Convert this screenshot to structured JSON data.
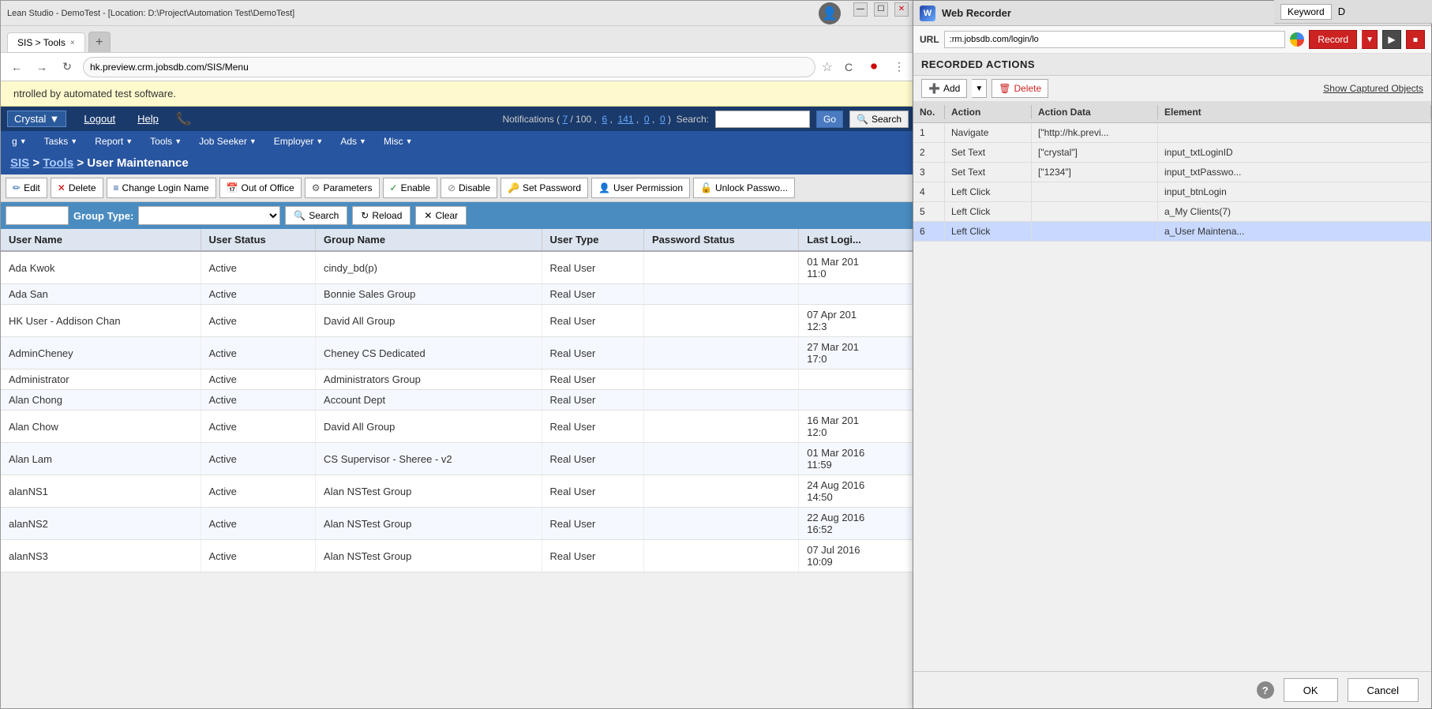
{
  "browser": {
    "titlebar_text": "Lean Studio - DemoTest - [Location: D:\\Project\\Automation Test\\DemoTest]",
    "tab_label": "SIS > Tools",
    "tab_close": "×",
    "url": "hk.preview.crm.jobsdb.com/SIS/Menu"
  },
  "automation_banner": {
    "text": "ntrolled by automated test software."
  },
  "nav": {
    "lang_label": "Crystal",
    "logout": "Logout",
    "help": "Help",
    "notifications_label": "Notifications ( 7 / 100 ,  6 , 141 ,  0 ,  0 )  Search:",
    "go_btn": "Go",
    "search_btn": "Search",
    "menu_items": [
      {
        "label": "g",
        "has_arrow": true
      },
      {
        "label": "Tasks",
        "has_arrow": true
      },
      {
        "label": "Report",
        "has_arrow": true
      },
      {
        "label": "Tools",
        "has_arrow": true
      },
      {
        "label": "Job Seeker",
        "has_arrow": true
      },
      {
        "label": "Employer",
        "has_arrow": true
      },
      {
        "label": "Ads",
        "has_arrow": true
      },
      {
        "label": "Misc",
        "has_arrow": true
      }
    ]
  },
  "breadcrumb": {
    "parts": [
      "SIS",
      "Tools",
      "User Maintenance"
    ]
  },
  "action_toolbar": {
    "buttons": [
      {
        "icon": "✏️",
        "label": "Edit"
      },
      {
        "icon": "✕",
        "label": "Delete",
        "color": "red"
      },
      {
        "icon": "≡",
        "label": "Change Login Name"
      },
      {
        "icon": "📅",
        "label": "Out of Office"
      },
      {
        "icon": "⚙",
        "label": "Parameters"
      },
      {
        "icon": "✓",
        "label": "Enable"
      },
      {
        "icon": "⊘",
        "label": "Disable"
      },
      {
        "icon": "🔑",
        "label": "Set Password"
      },
      {
        "icon": "👤",
        "label": "User Permission"
      },
      {
        "icon": "🔓",
        "label": "Unlock Passwo..."
      }
    ]
  },
  "filter_bar": {
    "group_type_label": "Group Type:",
    "search_btn": "Search",
    "reload_btn": "Reload",
    "clear_btn": "Clear"
  },
  "table": {
    "headers": [
      "User Name",
      "User Status",
      "Group Name",
      "User Type",
      "Password Status",
      "Last Logi..."
    ],
    "rows": [
      {
        "username": "Ada Kwok",
        "status": "Active",
        "group": "cindy_bd(p)",
        "type": "Real User",
        "pwd_status": "",
        "last_login": "01 Mar 201\n11:0"
      },
      {
        "username": "Ada San",
        "status": "Active",
        "group": "Bonnie Sales Group",
        "type": "Real User",
        "pwd_status": "",
        "last_login": ""
      },
      {
        "username": "HK User - Addison Chan",
        "status": "Active",
        "group": "David All Group",
        "type": "Real User",
        "pwd_status": "",
        "last_login": "07 Apr 201\n12:3"
      },
      {
        "username": "AdminCheney",
        "status": "Active",
        "group": "Cheney CS Dedicated",
        "type": "Real User",
        "pwd_status": "",
        "last_login": "27 Mar 201\n17:0"
      },
      {
        "username": "Administrator",
        "status": "Active",
        "group": "Administrators Group",
        "type": "Real User",
        "pwd_status": "",
        "last_login": ""
      },
      {
        "username": "Alan Chong",
        "status": "Active",
        "group": "Account Dept",
        "type": "Real User",
        "pwd_status": "",
        "last_login": ""
      },
      {
        "username": "Alan Chow",
        "status": "Active",
        "group": "David All Group",
        "type": "Real User",
        "pwd_status": "",
        "last_login": "16 Mar 201\n12:0"
      },
      {
        "username": "Alan Lam",
        "status": "Active",
        "group": "CS Supervisor - Sheree - v2",
        "type": "Real User",
        "pwd_status": "",
        "last_login": "01 Mar 2016\n11:59"
      },
      {
        "username": "alanNS1",
        "status": "Active",
        "group": "Alan NSTest Group",
        "type": "Real User",
        "pwd_status": "",
        "last_login": "24 Aug 2016\n14:50"
      },
      {
        "username": "alanNS2",
        "status": "Active",
        "group": "Alan NSTest Group",
        "type": "Real User",
        "pwd_status": "",
        "last_login": "22 Aug 2016\n16:52"
      },
      {
        "username": "alanNS3",
        "status": "Active",
        "group": "Alan NSTest Group",
        "type": "Real User",
        "pwd_status": "",
        "last_login": "07 Jul 2016\n10:09"
      }
    ]
  },
  "recorder": {
    "title": "Web Recorder",
    "url_label": "URL",
    "url_value": ":rm.jobsdb.com/login/lo",
    "record_btn": "Record",
    "recorded_actions_title": "RECORDED ACTIONS",
    "add_btn": "Add",
    "delete_btn": "Delete",
    "show_captured": "Show Captured Objects",
    "table_headers": [
      "No.",
      "Action",
      "Action Data",
      "Element"
    ],
    "rows": [
      {
        "no": "1",
        "action": "Navigate",
        "data": "[\"http://hk.previ...",
        "element": ""
      },
      {
        "no": "2",
        "action": "Set Text",
        "data": "[\"crystal\"]",
        "element": "input_txtLoginID"
      },
      {
        "no": "3",
        "action": "Set Text",
        "data": "[\"1234\"]",
        "element": "input_txtPasswo..."
      },
      {
        "no": "4",
        "action": "Left Click",
        "data": "",
        "element": "input_btnLogin"
      },
      {
        "no": "5",
        "action": "Left Click",
        "data": "",
        "element": "a_My Clients(7)"
      },
      {
        "no": "6",
        "action": "Left Click",
        "data": "",
        "element": "a_User Maintena..."
      }
    ],
    "selected_row": 5,
    "ok_btn": "OK",
    "cancel_btn": "Cancel"
  },
  "windows_taskbar": {
    "keyword_btn": "Keyword",
    "d_label": "D"
  }
}
